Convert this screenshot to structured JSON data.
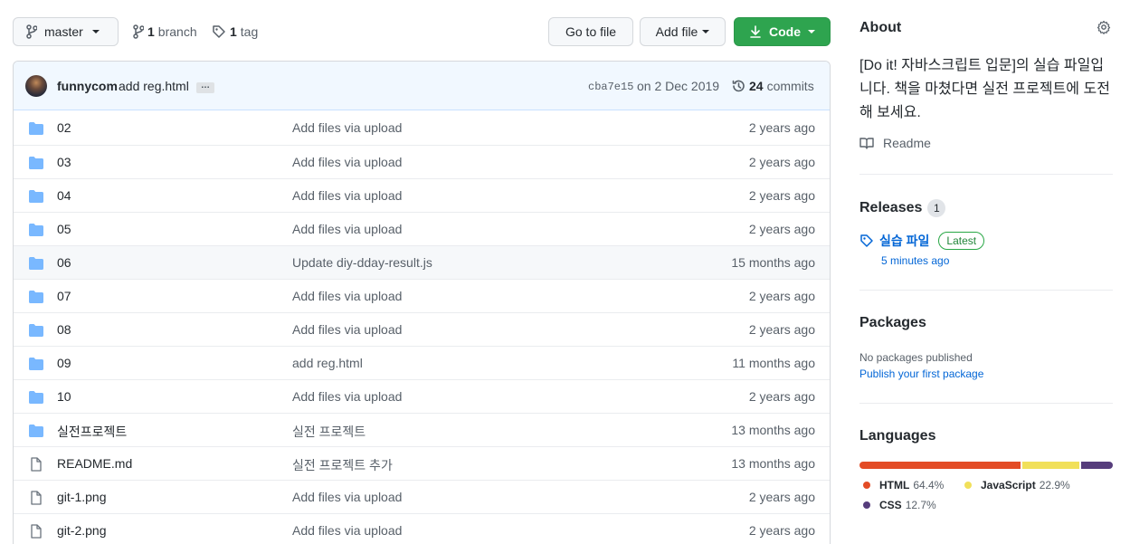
{
  "toolbar": {
    "branch_name": "master",
    "branch_count": "1",
    "branch_label": "branch",
    "tag_count": "1",
    "tag_label": "tag",
    "goto_label": "Go to file",
    "addfile_label": "Add file",
    "code_label": "Code"
  },
  "commit": {
    "author": "funnycom",
    "message": "add reg.html",
    "ellipsis": "…",
    "sha": "cba7e15",
    "date": "on 2 Dec 2019",
    "count": "24",
    "count_label": "commits"
  },
  "files": [
    {
      "type": "dir",
      "name": "02",
      "message": "Add files via upload",
      "age": "2 years ago"
    },
    {
      "type": "dir",
      "name": "03",
      "message": "Add files via upload",
      "age": "2 years ago"
    },
    {
      "type": "dir",
      "name": "04",
      "message": "Add files via upload",
      "age": "2 years ago"
    },
    {
      "type": "dir",
      "name": "05",
      "message": "Add files via upload",
      "age": "2 years ago"
    },
    {
      "type": "dir",
      "name": "06",
      "message": "Update diy-dday-result.js",
      "age": "15 months ago"
    },
    {
      "type": "dir",
      "name": "07",
      "message": "Add files via upload",
      "age": "2 years ago"
    },
    {
      "type": "dir",
      "name": "08",
      "message": "Add files via upload",
      "age": "2 years ago"
    },
    {
      "type": "dir",
      "name": "09",
      "message": "add reg.html",
      "age": "11 months ago"
    },
    {
      "type": "dir",
      "name": "10",
      "message": "Add files via upload",
      "age": "2 years ago"
    },
    {
      "type": "dir",
      "name": "실전프로젝트",
      "message": "실전 프로젝트",
      "age": "13 months ago"
    },
    {
      "type": "file",
      "name": "README.md",
      "message": "실전 프로젝트 추가",
      "age": "13 months ago"
    },
    {
      "type": "file",
      "name": "git-1.png",
      "message": "Add files via upload",
      "age": "2 years ago"
    },
    {
      "type": "file",
      "name": "git-2.png",
      "message": "Add files via upload",
      "age": "2 years ago"
    }
  ],
  "about": {
    "title": "About",
    "description": "[Do it! 자바스크립트 입문]의 실습 파일입니다. 책을 마쳤다면 실전 프로젝트에 도전해 보세요.",
    "readme_label": "Readme"
  },
  "releases": {
    "title": "Releases",
    "count": "1",
    "latest_name": "실습 파일",
    "latest_badge": "Latest",
    "latest_time": "5 minutes ago"
  },
  "packages": {
    "title": "Packages",
    "none_text": "No packages published",
    "publish_link": "Publish your first package"
  },
  "languages": {
    "title": "Languages",
    "items": [
      {
        "name": "HTML",
        "percent": "64.4%",
        "value": 64.4,
        "color": "#e34c26"
      },
      {
        "name": "JavaScript",
        "percent": "22.9%",
        "value": 22.9,
        "color": "#f1e05a"
      },
      {
        "name": "CSS",
        "percent": "12.7%",
        "value": 12.7,
        "color": "#563d7c"
      }
    ]
  },
  "icons": {
    "branch": "git-branch-icon",
    "tag": "tag-icon",
    "download": "download-icon",
    "history": "history-icon",
    "folder": "folder-icon",
    "file": "file-icon",
    "gear": "gear-icon",
    "book": "book-icon"
  }
}
